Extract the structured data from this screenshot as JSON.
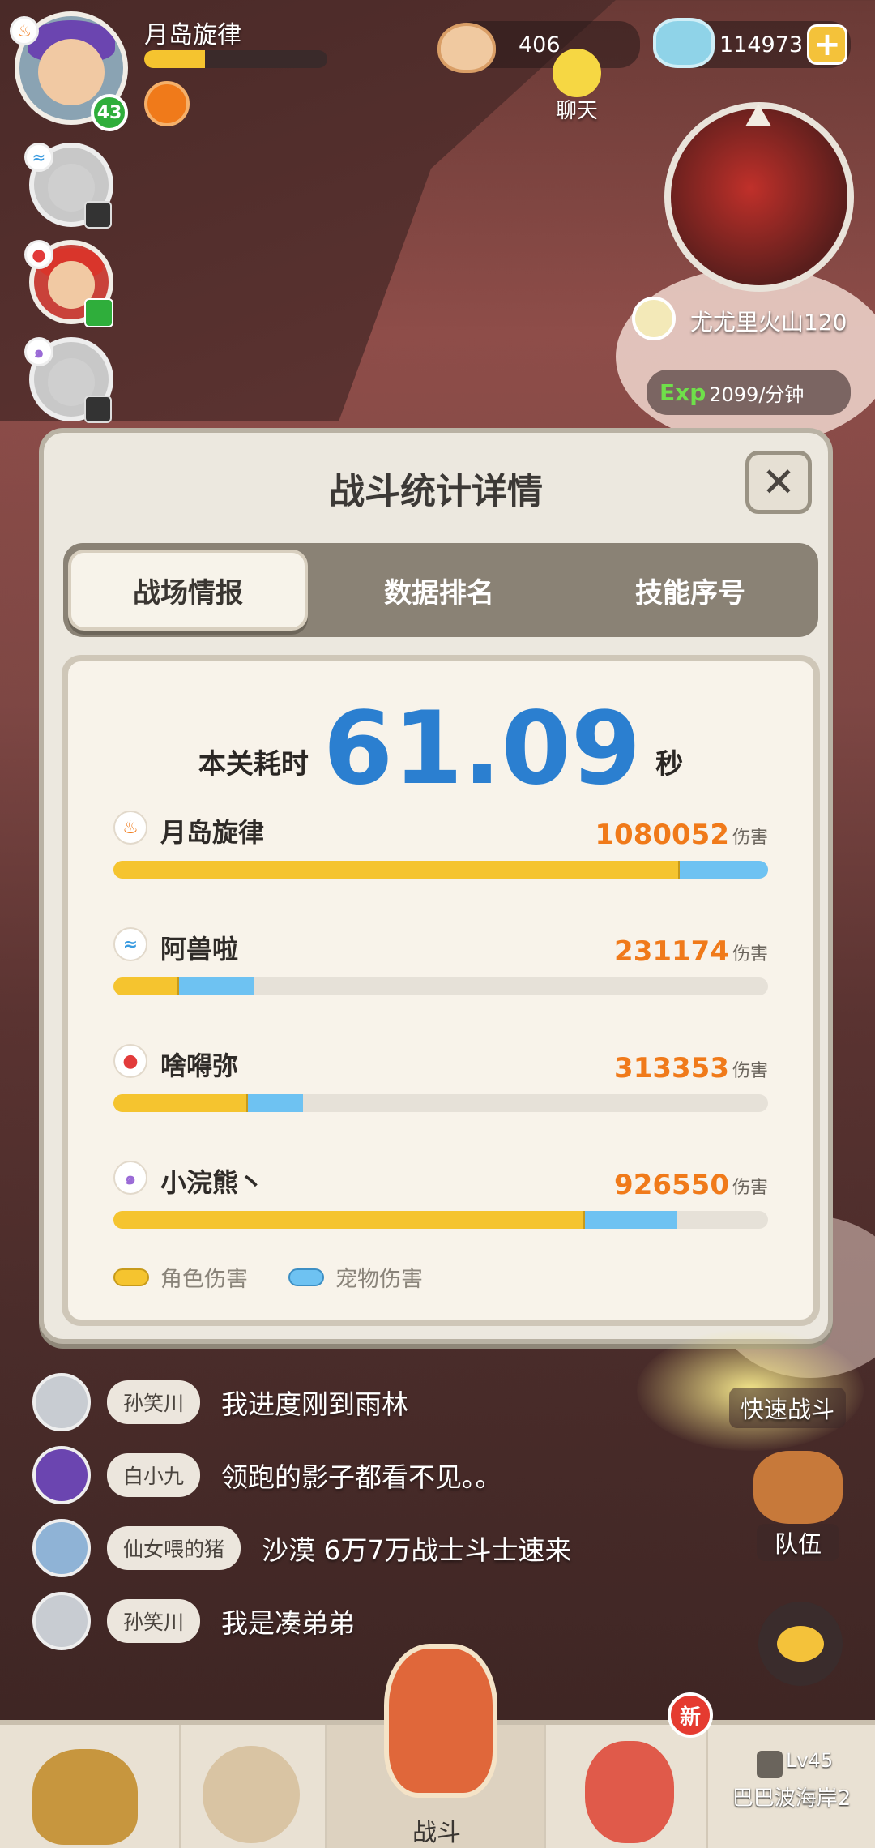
{
  "hud": {
    "player_name": "月岛旋律",
    "player_level": "43",
    "shell_count": "406",
    "gem_count": "114973",
    "chat_label": "聊天",
    "location": "尤尤里火山120",
    "exp_label": "Exp",
    "exp_rate": "2099/分钟"
  },
  "panel": {
    "title": "战斗统计详情",
    "tabs": [
      "战场情报",
      "数据排名",
      "技能序号"
    ],
    "time_label": "本关耗时",
    "time_value": "61.09",
    "time_unit": "秒",
    "damage_unit": "伤害",
    "members": [
      {
        "name": "月岛旋律",
        "damage": "1080052",
        "element_icon": "fire-icon",
        "char_frac": 0.865,
        "pet_frac": 0.135
      },
      {
        "name": "阿兽啦",
        "damage": "231174",
        "element_icon": "water-icon",
        "char_frac": 0.1,
        "pet_frac": 0.115
      },
      {
        "name": "啥嘚弥",
        "damage": "313353",
        "element_icon": "flame-icon",
        "char_frac": 0.205,
        "pet_frac": 0.085
      },
      {
        "name": "小浣熊丶",
        "damage": "926550",
        "element_icon": "psychic-icon",
        "char_frac": 0.72,
        "pet_frac": 0.14
      }
    ],
    "legend": {
      "char": "角色伤害",
      "pet": "宠物伤害"
    },
    "colors": {
      "char": "#f5c42f",
      "pet": "#6ec2f2",
      "accent": "#2b7fd0",
      "damage": "#f07a1a"
    }
  },
  "chat": [
    {
      "name": "孙笑川",
      "message": "我进度刚到雨林"
    },
    {
      "name": "白小九",
      "message": "领跑的影子都看不见。。"
    },
    {
      "name": "仙女喂的猪",
      "message": "沙漠 6万7万战士斗士速来"
    },
    {
      "name": "孙笑川",
      "message": "我是凑弟弟"
    }
  ],
  "side_buttons": {
    "quick_battle": "快速战斗",
    "team": "队伍"
  },
  "bottom_nav": {
    "battle_label": "战斗",
    "new_badge": "新",
    "level_label": "Lv45",
    "area_label": "巴巴波海岸2"
  }
}
